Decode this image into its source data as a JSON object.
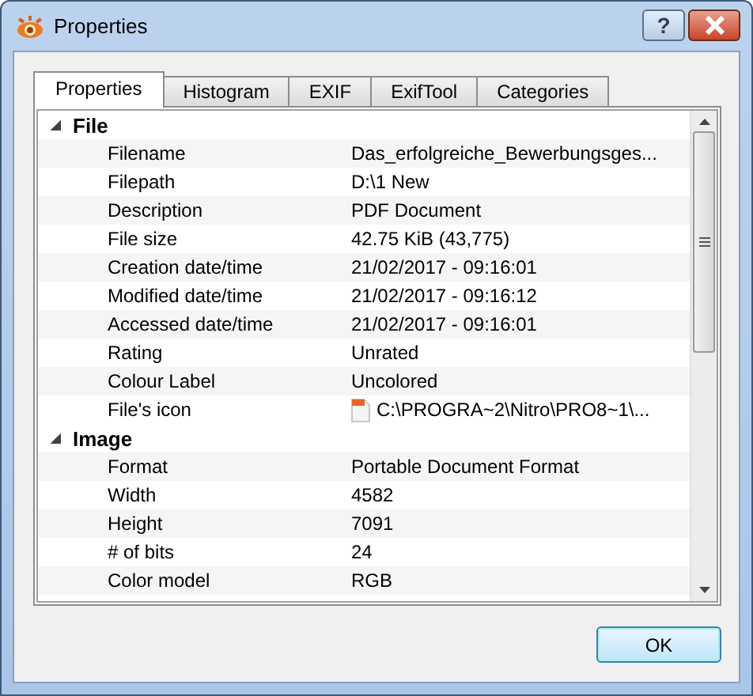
{
  "window": {
    "title": "Properties",
    "help_button": "?"
  },
  "tabs": [
    {
      "label": "Properties",
      "selected": true
    },
    {
      "label": "Histogram",
      "selected": false
    },
    {
      "label": "EXIF",
      "selected": false
    },
    {
      "label": "ExifTool",
      "selected": false
    },
    {
      "label": "Categories",
      "selected": false
    }
  ],
  "groups": [
    {
      "name": "File",
      "expanded": true,
      "rows": [
        {
          "kind": "text",
          "label": "Filename",
          "value": "Das_erfolgreiche_Bewerbungsges..."
        },
        {
          "kind": "text",
          "label": "Filepath",
          "value": "D:\\1 New"
        },
        {
          "kind": "text",
          "label": "Description",
          "value": "PDF Document"
        },
        {
          "kind": "text",
          "label": "File size",
          "value": "42.75 KiB (43,775)"
        },
        {
          "kind": "text",
          "label": "Creation date/time",
          "value": "21/02/2017 - 09:16:01"
        },
        {
          "kind": "text",
          "label": "Modified date/time",
          "value": "21/02/2017 - 09:16:12"
        },
        {
          "kind": "text",
          "label": "Accessed date/time",
          "value": "21/02/2017 - 09:16:01"
        },
        {
          "kind": "text",
          "label": "Rating",
          "value": "Unrated"
        },
        {
          "kind": "text",
          "label": "Colour Label",
          "value": "Uncolored"
        },
        {
          "kind": "icon",
          "label": "File's icon",
          "value": "C:\\PROGRA~2\\Nitro\\PRO8~1\\..."
        }
      ]
    },
    {
      "name": "Image",
      "expanded": true,
      "rows": [
        {
          "kind": "text",
          "label": "Format",
          "value": "Portable Document Format"
        },
        {
          "kind": "text",
          "label": "Width",
          "value": "4582"
        },
        {
          "kind": "text",
          "label": "Height",
          "value": "7091"
        },
        {
          "kind": "text",
          "label": "# of bits",
          "value": "24"
        },
        {
          "kind": "text",
          "label": "Color model",
          "value": "RGB"
        }
      ]
    }
  ],
  "buttons": [
    "OK"
  ]
}
